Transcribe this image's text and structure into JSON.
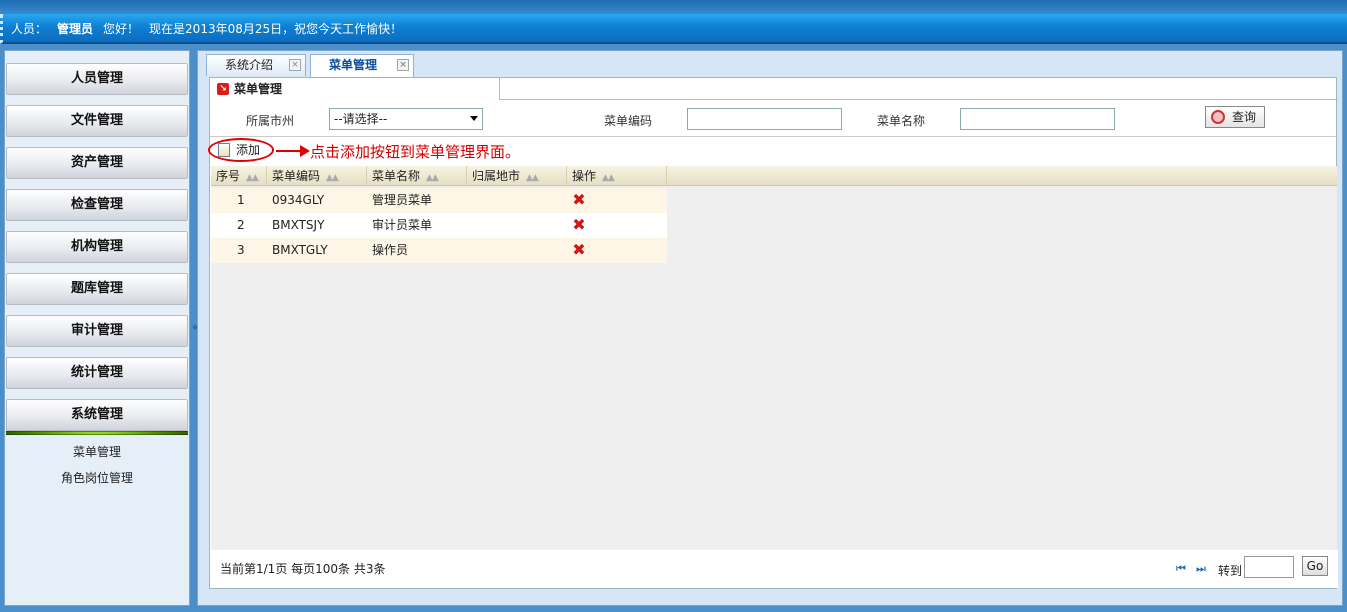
{
  "header": {
    "user_label": "人员：",
    "user_name": "管理员",
    "greeting": "您好！",
    "date_text": "现在是2013年08月25日，祝您今天工作愉快！"
  },
  "sidebar": {
    "items": [
      {
        "label": "人员管理"
      },
      {
        "label": "文件管理"
      },
      {
        "label": "资产管理"
      },
      {
        "label": "检查管理"
      },
      {
        "label": "机构管理"
      },
      {
        "label": "题库管理"
      },
      {
        "label": "审计管理"
      },
      {
        "label": "统计管理"
      },
      {
        "label": "系统管理"
      }
    ],
    "subitems": [
      {
        "label": "菜单管理"
      },
      {
        "label": "角色岗位管理"
      }
    ],
    "collapse_glyph": "«"
  },
  "tabs": [
    {
      "label": "系统介绍",
      "close": "×"
    },
    {
      "label": "菜单管理",
      "close": "×"
    }
  ],
  "panel": {
    "title": "菜单管理",
    "icon": "↘"
  },
  "search": {
    "city_label": "所属市州",
    "city_selected": "--请选择--",
    "code_label": "菜单编码",
    "code_value": "",
    "name_label": "菜单名称",
    "name_value": "",
    "query_label": "查询"
  },
  "toolbar": {
    "add_label": "添加",
    "annotation": "点击添加按钮到菜单管理界面。"
  },
  "table": {
    "columns": [
      "序号",
      "菜单编码",
      "菜单名称",
      "归属地市",
      "操作"
    ],
    "sort_glyph": "▲▲",
    "rows": [
      {
        "no": "1",
        "code": "0934GLY",
        "name": "管理员菜单",
        "city": "",
        "action": "✖"
      },
      {
        "no": "2",
        "code": "BMXTSJY",
        "name": "审计员菜单",
        "city": "",
        "action": "✖"
      },
      {
        "no": "3",
        "code": "BMXTGLY",
        "name": "操作员",
        "city": "",
        "action": "✖"
      }
    ]
  },
  "pager": {
    "info": "当前第1/1页  每页100条  共3条",
    "first_glyph": "⏮",
    "last_glyph": "⏭",
    "goto_label": "转到",
    "goto_value": "",
    "go_label": "Go"
  },
  "colors": {
    "banner": "#0f7fd2",
    "header_bg": "#e6dfc4",
    "accent_red": "#e00000",
    "delete_red": "#d31414"
  }
}
